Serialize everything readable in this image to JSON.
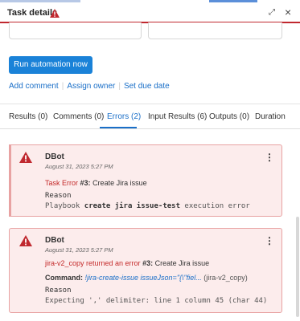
{
  "header": {
    "title": "Task details",
    "expand_icon": "expand-icon",
    "close_icon": "close-icon",
    "warning_icon": "warning-icon"
  },
  "actions": {
    "run_button": "Run automation now",
    "add_comment": "Add comment",
    "assign_owner": "Assign owner",
    "set_due_date": "Set due date"
  },
  "tabs": [
    {
      "label": "Results (0)"
    },
    {
      "label": "Comments (0)"
    },
    {
      "label": "Errors (2)",
      "active": true
    },
    {
      "label": "Input Results (6)"
    },
    {
      "label": "Outputs (0)"
    },
    {
      "label": "Duration"
    }
  ],
  "errors": [
    {
      "author": "DBot",
      "timestamp": "August 31, 2023 5:27 PM",
      "error_label": "Task Error",
      "task_ref": "#3:",
      "task_name": "Create Jira issue",
      "reason_label": "Reason",
      "reason_prefix": "Playbook",
      "reason_bold": "create jira issue-test",
      "reason_suffix": "execution error"
    },
    {
      "author": "DBot",
      "timestamp": "August 31, 2023 5:27 PM",
      "error_label": "jira-v2_copy returned an error",
      "task_ref": "#3:",
      "task_name": "Create Jira issue",
      "command_label": "Command:",
      "command_value": "!jira-create-issue issueJson=\"{\\\"fiel...",
      "command_source": "(jira-v2_copy)",
      "reason_label": "Reason",
      "reason_text": "Expecting ',' delimiter: line 1 column 45 (char 44)"
    }
  ],
  "colors": {
    "accent": "#1a82d8",
    "error_red": "#c42a2a",
    "card_bg": "#fcecec",
    "card_border": "#e8a2a2"
  }
}
